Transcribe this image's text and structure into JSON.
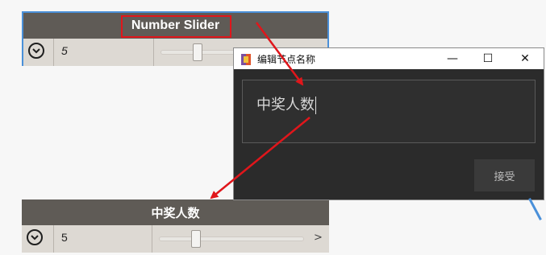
{
  "node_top": {
    "title": "Number Slider",
    "value": "5",
    "slider_fraction": 0.38
  },
  "dialog": {
    "title": "编辑节点名称",
    "minimize_glyph": "—",
    "maximize_glyph": "☐",
    "close_glyph": "✕",
    "name_value": "中奖人数",
    "accept_label": "接受"
  },
  "node_bottom": {
    "title": "中奖人数",
    "value": "5",
    "slider_fraction": 0.38,
    "expand_glyph": ">"
  },
  "colors": {
    "annotation_red": "#e0161b",
    "selection_blue": "#4a90d9",
    "node_header": "#5f5b56",
    "dialog_bg": "#2b2b2b"
  }
}
